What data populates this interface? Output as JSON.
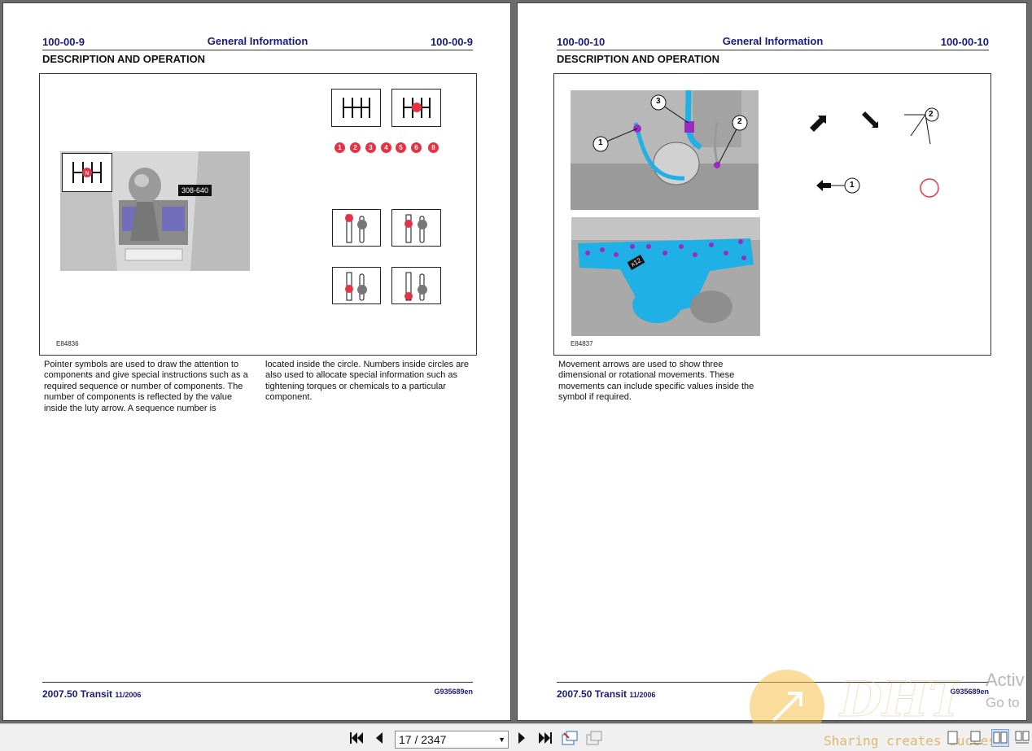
{
  "left_page": {
    "page_number_left": "100-00-9",
    "title": "General Information",
    "page_number_right": "100-00-9",
    "section": "DESCRIPTION AND OPERATION",
    "figure": {
      "code": "E84836",
      "tool_label": "308-640",
      "sequence_numbers": [
        "1",
        "2",
        "3",
        "4",
        "5",
        "6",
        "8"
      ]
    },
    "text_col1": "Pointer symbols are used to draw the attention to components and give special instructions such as a required sequence or number of components. The number of components is reflected by the value inside the luty arrow. A sequence number is",
    "text_col2": "located inside the circle. Numbers inside circles are also used to allocate special information such as tightening torques or chemicals to a particular component.",
    "footer_model": "2007.50 Transit",
    "footer_date": "11/2006",
    "footer_code": "G935689en"
  },
  "right_page": {
    "page_number_left": "100-00-10",
    "title": "General Information",
    "page_number_right": "100-00-10",
    "section": "DESCRIPTION AND OPERATION",
    "figure": {
      "code": "E84837",
      "callouts": [
        "1",
        "2",
        "3"
      ],
      "bolt_label": "x12",
      "symbol_callouts": [
        "2",
        "1"
      ]
    },
    "text": "Movement arrows are used to show three dimensional or rotational movements. These movements can include specific values inside the symbol if required.",
    "footer_model": "2007.50 Transit",
    "footer_date": "11/2006",
    "footer_code": "G935689en"
  },
  "toolbar": {
    "page_indicator": "17 / 2347",
    "buttons": [
      "first-page",
      "previous-page",
      "next-page",
      "last-page",
      "fit-page",
      "fit-width"
    ]
  },
  "watermark": {
    "text": "Sharing creates success"
  },
  "os_overlay": {
    "line1": "Activ",
    "line2": "Go to"
  },
  "colors": {
    "heading": "#1a1a7a",
    "sequence_red": "#e53346",
    "engine_blue": "#1fb0e6",
    "bolt_purple": "#9b2bbf"
  }
}
